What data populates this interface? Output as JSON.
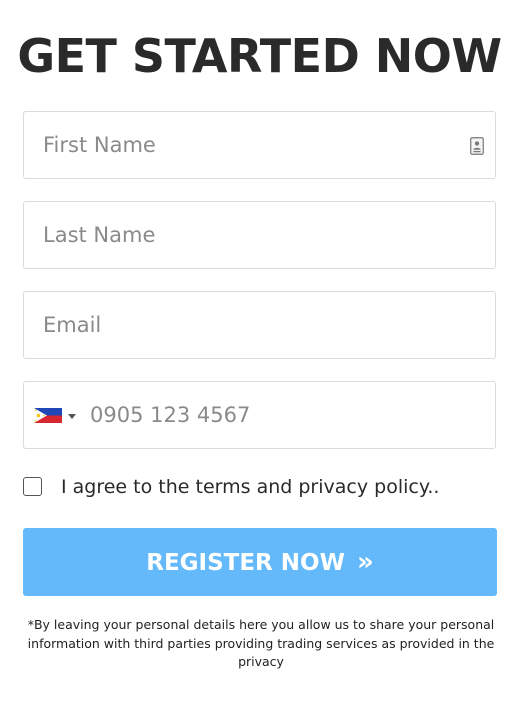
{
  "form": {
    "title": "GET STARTED NOW",
    "first_name": {
      "placeholder": "First Name",
      "value": ""
    },
    "last_name": {
      "placeholder": "Last Name",
      "value": ""
    },
    "email": {
      "placeholder": "Email",
      "value": ""
    },
    "phone": {
      "placeholder": "0905 123 4567",
      "value": "",
      "country_flag": "philippines-flag-icon",
      "dropdown_icon": "caret-down-icon"
    },
    "contact_icon": "contact-card-icon",
    "agree": {
      "checked": false,
      "prefix": "I agree to the ",
      "terms_link": "terms",
      "middle": " and ",
      "privacy_link": "privacy policy",
      "suffix": ".."
    },
    "register_button": {
      "label": "REGISTER NOW",
      "arrow": "»",
      "color": "#64b9fb"
    },
    "disclaimer": "*By leaving your personal details here you allow us to share your personal information with third parties providing trading services as provided in the privacy"
  }
}
